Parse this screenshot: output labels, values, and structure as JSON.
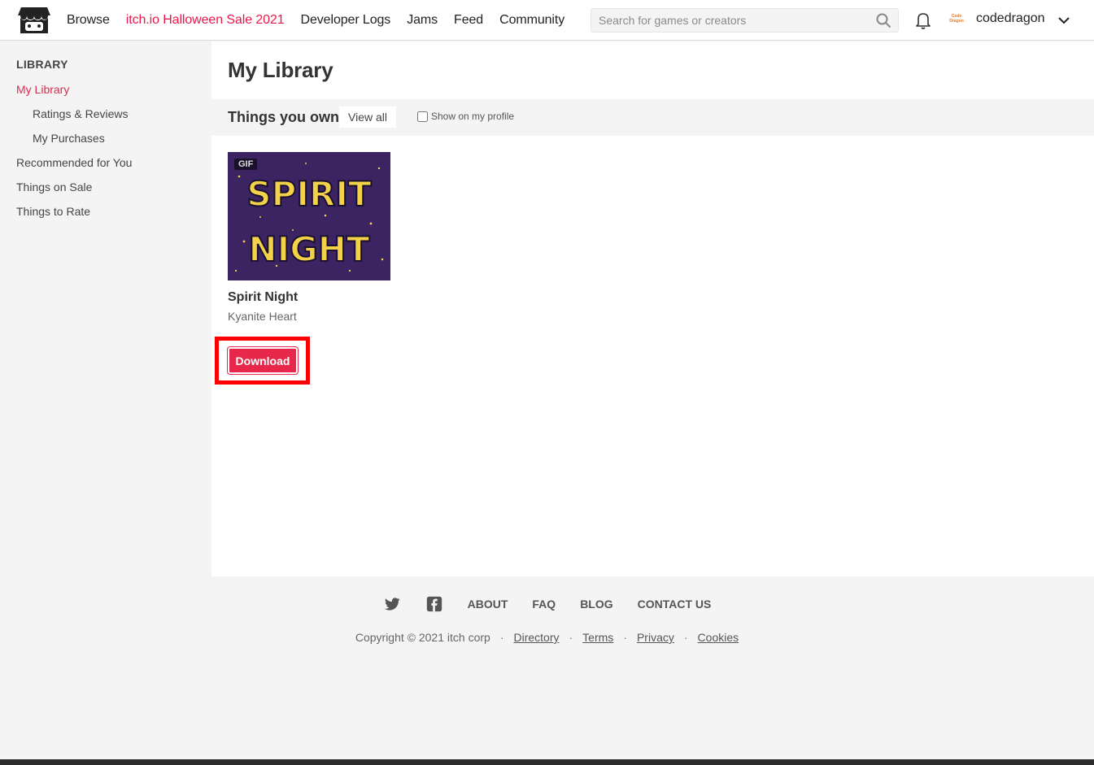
{
  "header": {
    "nav": [
      "Browse",
      "itch.io Halloween Sale 2021",
      "Developer Logs",
      "Jams",
      "Feed",
      "Community"
    ],
    "search_placeholder": "Search for games or creators",
    "avatar_text": "Code Dragon",
    "username": "codedragon"
  },
  "sidebar": {
    "heading": "LIBRARY",
    "items": [
      "My Library",
      "Ratings & Reviews",
      "My Purchases",
      "Recommended for You",
      "Things on Sale",
      "Things to Rate"
    ]
  },
  "main": {
    "title": "My Library",
    "section_title": "Things you own",
    "view_all": "View all",
    "show_on_profile": "Show on my profile",
    "game": {
      "badge": "GIF",
      "cover_line1": "SPIRIT",
      "cover_line2": "NIGHT",
      "title": "Spirit Night",
      "author": "Kyanite Heart",
      "download": "Download"
    }
  },
  "footer": {
    "links": [
      "ABOUT",
      "FAQ",
      "BLOG",
      "CONTACT US"
    ],
    "copyright": "Copyright © 2021 itch corp",
    "legal": [
      "Directory",
      "Terms",
      "Privacy",
      "Cookies"
    ]
  },
  "colors": {
    "accent": "#e8284b",
    "sale": "#e8184a",
    "highlight": "#ff0000"
  }
}
